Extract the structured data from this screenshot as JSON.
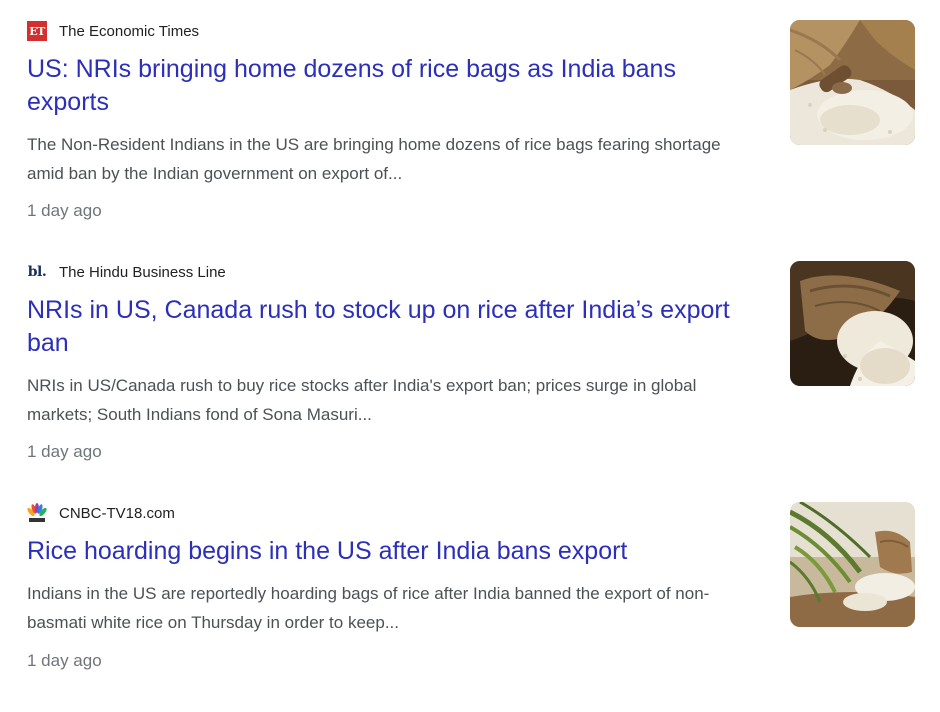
{
  "articles": [
    {
      "source": "The Economic Times",
      "favicon_icon": "economic-times-logo-icon",
      "favicon_text": "ET",
      "headline": "US: NRIs bringing home dozens of rice bags as India bans exports",
      "snippet": "The Non-Resident Indians in the US are bringing home dozens of rice bags fearing shortage amid ban by the Indian government on export of...",
      "time": "1 day ago",
      "thumbnail": "rice-sack-image"
    },
    {
      "source": "The Hindu Business Line",
      "favicon_icon": "hindu-business-line-logo-icon",
      "favicon_text": "bl.",
      "headline": "NRIs in US, Canada rush to stock up on rice after India’s export ban",
      "snippet": "NRIs in US/Canada rush to buy rice stocks after India's export ban; prices surge in global markets; South Indians fond of Sona Masuri...",
      "time": "1 day ago",
      "thumbnail": "rice-sack-image"
    },
    {
      "source": "CNBC-TV18.com",
      "favicon_icon": "cnbc-peacock-logo-icon",
      "headline": "Rice hoarding begins in the US after India bans export",
      "snippet": "Indians in the US are reportedly hoarding bags of rice after India banned the export of non-basmati white rice on Thursday in order to keep...",
      "time": "1 day ago",
      "thumbnail": "rice-stalks-image"
    }
  ],
  "colors": {
    "headline": "#2b2fb9",
    "snippet": "#4d5156",
    "timestamp": "#70757a",
    "source": "#202124",
    "et_red": "#d32f2f"
  }
}
